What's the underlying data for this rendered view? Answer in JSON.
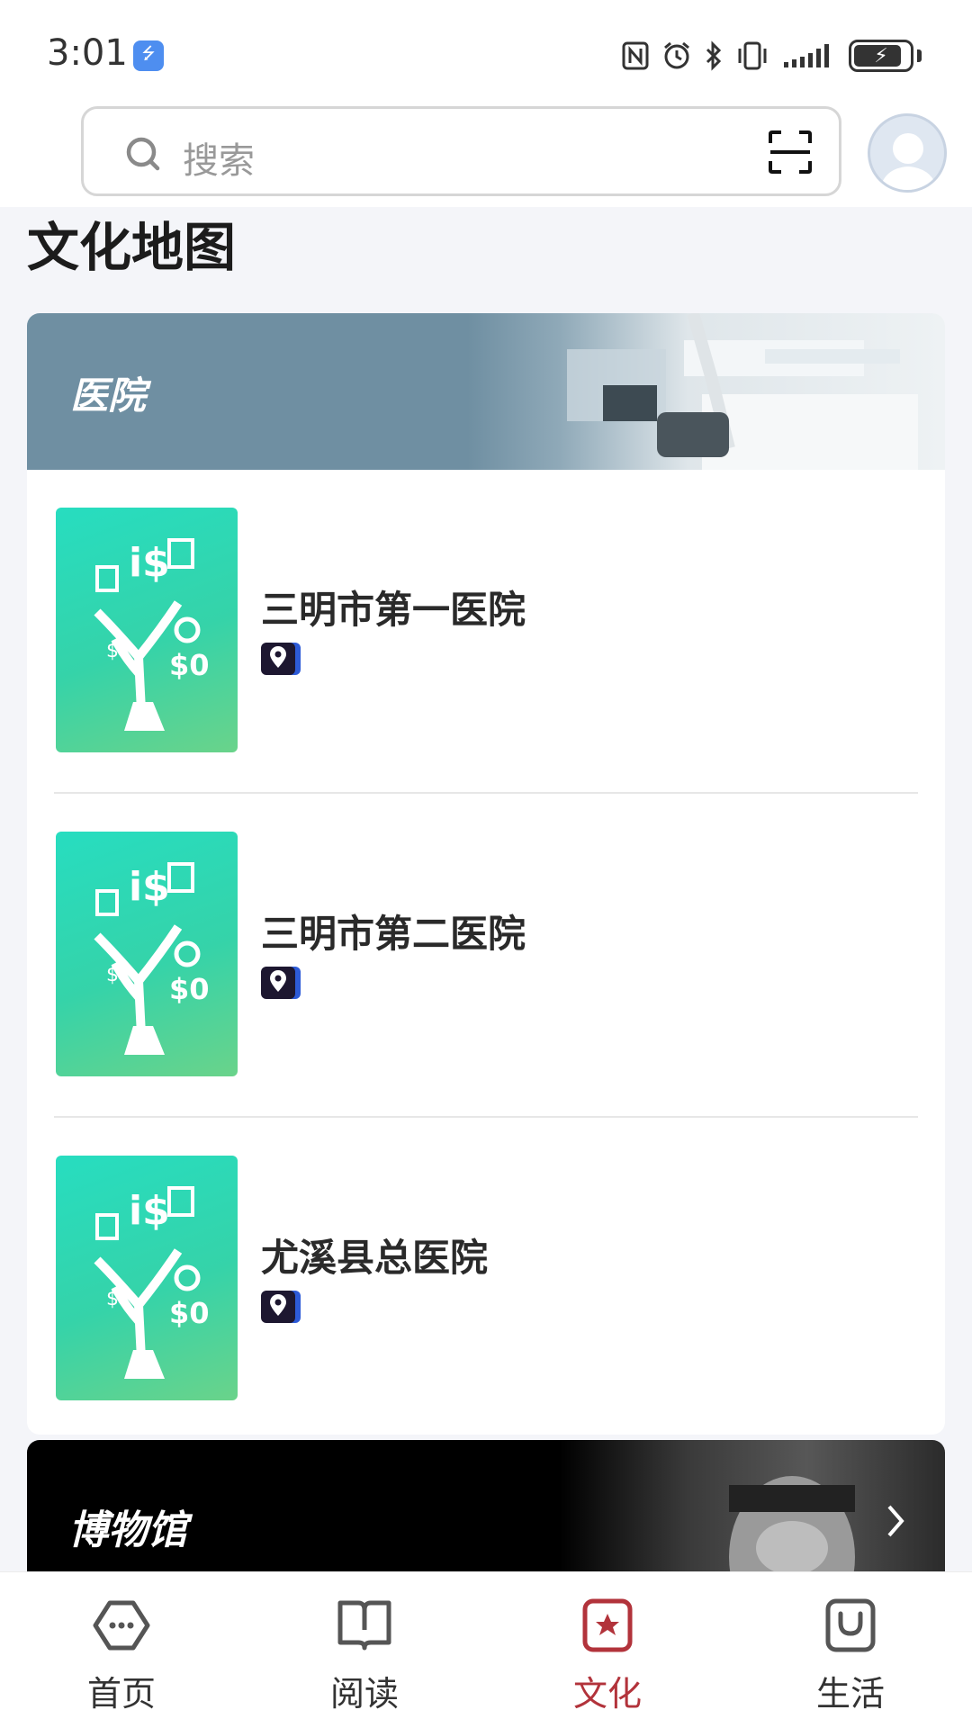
{
  "status_bar": {
    "time": "3:01",
    "usb_icon": "usb-icon",
    "icons": [
      "nfc-icon",
      "alarm-icon",
      "bluetooth-icon",
      "vibrate-icon",
      "signal-icon",
      "battery-charging-icon"
    ]
  },
  "header": {
    "search_placeholder": "搜索",
    "search_icon": "search-icon",
    "scan_icon": "scan-icon",
    "avatar_icon": "avatar-icon"
  },
  "main": {
    "section_title": "文化地图",
    "categories": [
      {
        "title": "医院",
        "items": [
          {
            "name": "三明市第一医院"
          },
          {
            "name": "三明市第二医院"
          },
          {
            "name": "尤溪县总医院"
          }
        ]
      },
      {
        "title": "博物馆"
      }
    ]
  },
  "bottom_nav": {
    "items": [
      {
        "label": "首页",
        "icon": "home-icon"
      },
      {
        "label": "阅读",
        "icon": "book-icon"
      },
      {
        "label": "文化",
        "icon": "star-icon"
      },
      {
        "label": "生活",
        "icon": "bag-icon"
      }
    ],
    "active_color": "#b2333b"
  },
  "colors": {
    "hospital_banner": "#6f8fa2",
    "thumb_gradient_start": "#27ddc0",
    "thumb_gradient_end": "#6ad38a"
  }
}
